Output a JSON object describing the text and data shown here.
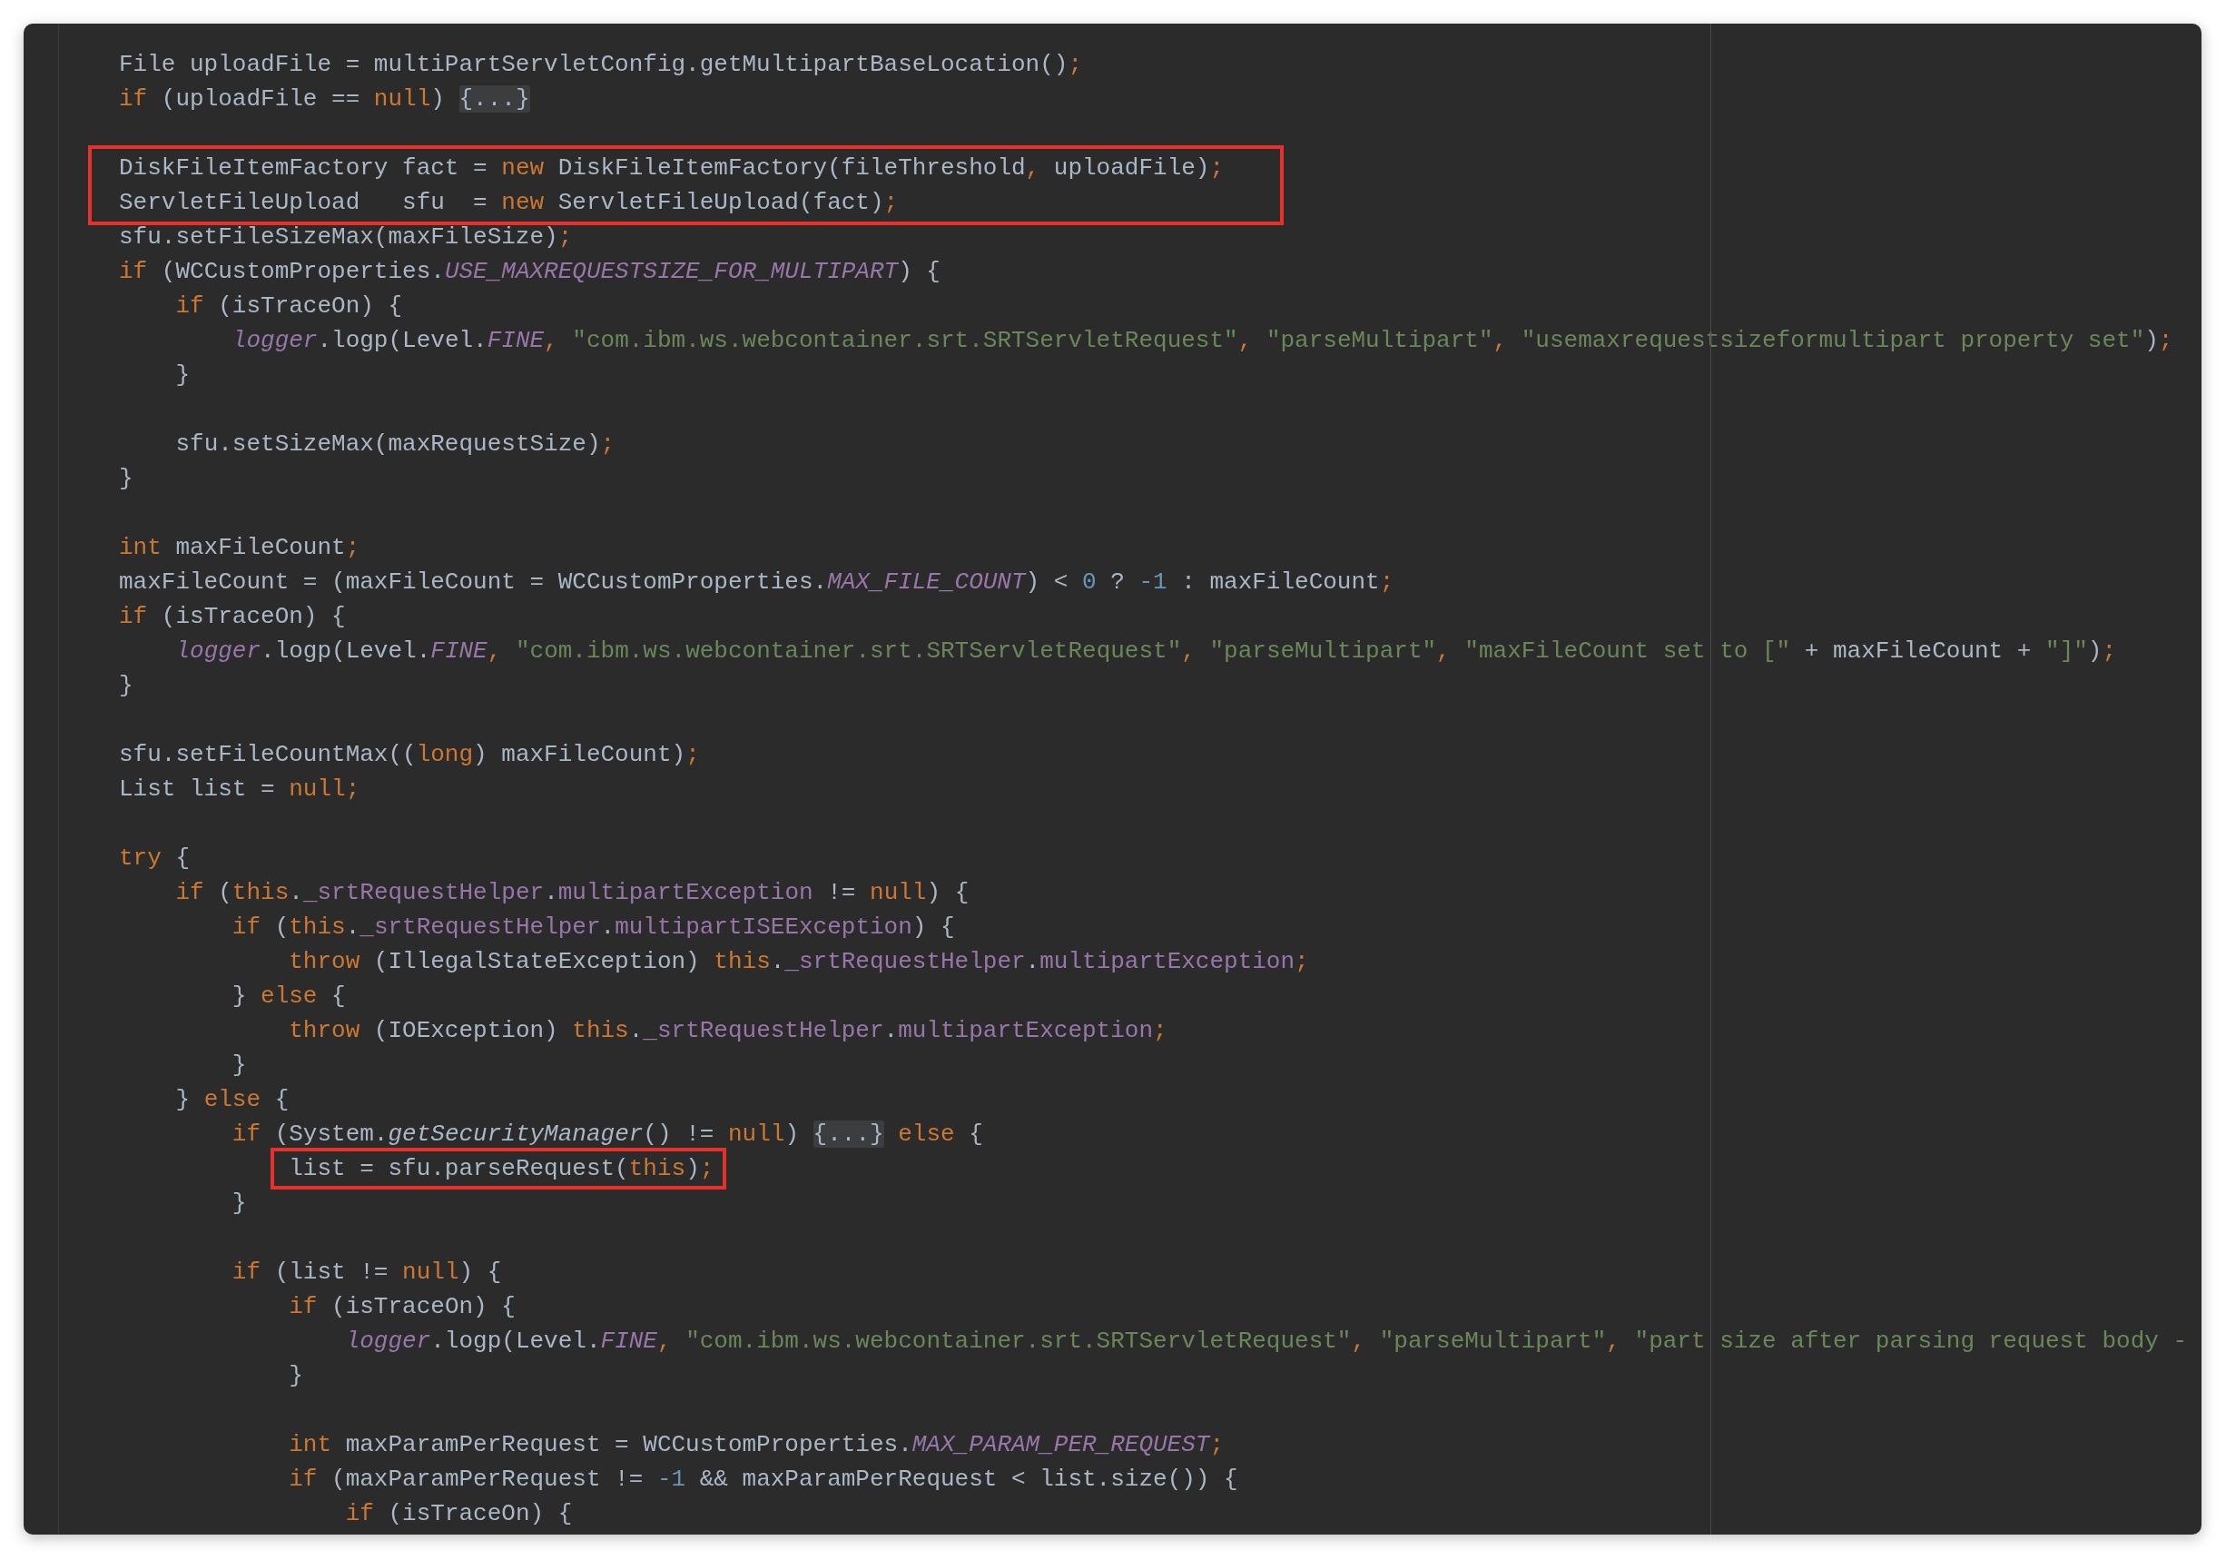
{
  "editor": {
    "lines": [
      {
        "kind": "code",
        "tokens": [
          {
            "kind": "plain",
            "text": "File uploadFile = multiPartServletConfig.getMultipartBaseLocation()"
          },
          {
            "kind": "keyword",
            "text": ";"
          }
        ]
      },
      {
        "kind": "code",
        "tokens": [
          {
            "kind": "keyword",
            "text": "if"
          },
          {
            "kind": "plain",
            "text": " (uploadFile == "
          },
          {
            "kind": "keyword",
            "text": "null"
          },
          {
            "kind": "plain",
            "text": ") "
          },
          {
            "kind": "fold",
            "text": "{...}"
          }
        ]
      },
      {
        "kind": "blank"
      },
      {
        "kind": "code",
        "boxed": true,
        "tokens": [
          {
            "kind": "plain",
            "text": "DiskFileItemFactory fact = "
          },
          {
            "kind": "keyword",
            "text": "new"
          },
          {
            "kind": "plain",
            "text": " DiskFileItemFactory(fileThreshold"
          },
          {
            "kind": "keyword",
            "text": ","
          },
          {
            "kind": "plain",
            "text": " uploadFile)"
          },
          {
            "kind": "keyword",
            "text": ";"
          }
        ]
      },
      {
        "kind": "code",
        "boxed": true,
        "tokens": [
          {
            "kind": "plain",
            "text": "ServletFileUpload   sfu  = "
          },
          {
            "kind": "keyword",
            "text": "new"
          },
          {
            "kind": "plain",
            "text": " ServletFileUpload(fact)"
          },
          {
            "kind": "keyword",
            "text": ";"
          }
        ]
      },
      {
        "kind": "code",
        "tokens": [
          {
            "kind": "plain",
            "text": "sfu.setFileSizeMax(maxFileSize)"
          },
          {
            "kind": "keyword",
            "text": ";"
          }
        ]
      },
      {
        "kind": "code",
        "tokens": [
          {
            "kind": "keyword",
            "text": "if"
          },
          {
            "kind": "plain",
            "text": " (WCCustomProperties."
          },
          {
            "kind": "static",
            "text": "USE_MAXREQUESTSIZE_FOR_MULTIPART"
          },
          {
            "kind": "plain",
            "text": ") {"
          }
        ]
      },
      {
        "kind": "code",
        "tokens": [
          {
            "kind": "keyword",
            "text": "    if"
          },
          {
            "kind": "plain",
            "text": " (isTraceOn) {"
          }
        ]
      },
      {
        "kind": "code",
        "tokens": [
          {
            "kind": "static",
            "text": "        logger"
          },
          {
            "kind": "plain",
            "text": ".logp(Level."
          },
          {
            "kind": "static",
            "text": "FINE"
          },
          {
            "kind": "keyword",
            "text": ", "
          },
          {
            "kind": "string",
            "text": "\"com.ibm.ws.webcontainer.srt.SRTServletRequest\""
          },
          {
            "kind": "keyword",
            "text": ", "
          },
          {
            "kind": "string",
            "text": "\"parseMultipart\""
          },
          {
            "kind": "keyword",
            "text": ", "
          },
          {
            "kind": "string",
            "text": "\"usemaxrequestsizeformultipart property set\""
          },
          {
            "kind": "plain",
            "text": ")"
          },
          {
            "kind": "keyword",
            "text": ";"
          }
        ]
      },
      {
        "kind": "code",
        "tokens": [
          {
            "kind": "plain",
            "text": "    }"
          }
        ]
      },
      {
        "kind": "blank"
      },
      {
        "kind": "code",
        "tokens": [
          {
            "kind": "plain",
            "text": "    sfu.setSizeMax(maxRequestSize)"
          },
          {
            "kind": "keyword",
            "text": ";"
          }
        ]
      },
      {
        "kind": "code",
        "tokens": [
          {
            "kind": "plain",
            "text": "}"
          }
        ]
      },
      {
        "kind": "blank"
      },
      {
        "kind": "code",
        "tokens": [
          {
            "kind": "keyword",
            "text": "int"
          },
          {
            "kind": "plain",
            "text": " maxFileCount"
          },
          {
            "kind": "keyword",
            "text": ";"
          }
        ]
      },
      {
        "kind": "code",
        "tokens": [
          {
            "kind": "plain",
            "text": "maxFileCount = (maxFileCount = WCCustomProperties."
          },
          {
            "kind": "static",
            "text": "MAX_FILE_COUNT"
          },
          {
            "kind": "plain",
            "text": ") < "
          },
          {
            "kind": "number",
            "text": "0"
          },
          {
            "kind": "plain",
            "text": " ? "
          },
          {
            "kind": "number",
            "text": "-1"
          },
          {
            "kind": "plain",
            "text": " : maxFileCount"
          },
          {
            "kind": "keyword",
            "text": ";"
          }
        ]
      },
      {
        "kind": "code",
        "tokens": [
          {
            "kind": "keyword",
            "text": "if"
          },
          {
            "kind": "plain",
            "text": " (isTraceOn) {"
          }
        ]
      },
      {
        "kind": "code",
        "tokens": [
          {
            "kind": "static",
            "text": "    logger"
          },
          {
            "kind": "plain",
            "text": ".logp(Level."
          },
          {
            "kind": "static",
            "text": "FINE"
          },
          {
            "kind": "keyword",
            "text": ", "
          },
          {
            "kind": "string",
            "text": "\"com.ibm.ws.webcontainer.srt.SRTServletRequest\""
          },
          {
            "kind": "keyword",
            "text": ", "
          },
          {
            "kind": "string",
            "text": "\"parseMultipart\""
          },
          {
            "kind": "keyword",
            "text": ", "
          },
          {
            "kind": "string",
            "text": "\"maxFileCount set to [\""
          },
          {
            "kind": "plain",
            "text": " + maxFileCount + "
          },
          {
            "kind": "string",
            "text": "\"]\""
          },
          {
            "kind": "plain",
            "text": ")"
          },
          {
            "kind": "keyword",
            "text": ";"
          }
        ]
      },
      {
        "kind": "code",
        "tokens": [
          {
            "kind": "plain",
            "text": "}"
          }
        ]
      },
      {
        "kind": "blank"
      },
      {
        "kind": "code",
        "tokens": [
          {
            "kind": "plain",
            "text": "sfu.setFileCountMax(("
          },
          {
            "kind": "keyword",
            "text": "long"
          },
          {
            "kind": "plain",
            "text": ") maxFileCount)"
          },
          {
            "kind": "keyword",
            "text": ";"
          }
        ]
      },
      {
        "kind": "code",
        "tokens": [
          {
            "kind": "plain",
            "text": "List list = "
          },
          {
            "kind": "keyword",
            "text": "null;"
          }
        ]
      },
      {
        "kind": "blank"
      },
      {
        "kind": "code",
        "tokens": [
          {
            "kind": "keyword",
            "text": "try"
          },
          {
            "kind": "plain",
            "text": " {"
          }
        ]
      },
      {
        "kind": "code",
        "tokens": [
          {
            "kind": "keyword",
            "text": "    if"
          },
          {
            "kind": "plain",
            "text": " ("
          },
          {
            "kind": "keyword",
            "text": "this"
          },
          {
            "kind": "plain",
            "text": "."
          },
          {
            "kind": "field",
            "text": "_srtRequestHelper"
          },
          {
            "kind": "plain",
            "text": "."
          },
          {
            "kind": "field",
            "text": "multipartException"
          },
          {
            "kind": "plain",
            "text": " != "
          },
          {
            "kind": "keyword",
            "text": "null"
          },
          {
            "kind": "plain",
            "text": ") {"
          }
        ]
      },
      {
        "kind": "code",
        "tokens": [
          {
            "kind": "keyword",
            "text": "        if"
          },
          {
            "kind": "plain",
            "text": " ("
          },
          {
            "kind": "keyword",
            "text": "this"
          },
          {
            "kind": "plain",
            "text": "."
          },
          {
            "kind": "field",
            "text": "_srtRequestHelper"
          },
          {
            "kind": "plain",
            "text": "."
          },
          {
            "kind": "field",
            "text": "multipartISEException"
          },
          {
            "kind": "plain",
            "text": ") {"
          }
        ]
      },
      {
        "kind": "code",
        "tokens": [
          {
            "kind": "keyword",
            "text": "            throw"
          },
          {
            "kind": "plain",
            "text": " (IllegalStateException) "
          },
          {
            "kind": "keyword",
            "text": "this"
          },
          {
            "kind": "plain",
            "text": "."
          },
          {
            "kind": "field",
            "text": "_srtRequestHelper"
          },
          {
            "kind": "plain",
            "text": "."
          },
          {
            "kind": "field",
            "text": "multipartException"
          },
          {
            "kind": "keyword",
            "text": ";"
          }
        ]
      },
      {
        "kind": "code",
        "tokens": [
          {
            "kind": "plain",
            "text": "        } "
          },
          {
            "kind": "keyword",
            "text": "else"
          },
          {
            "kind": "plain",
            "text": " {"
          }
        ]
      },
      {
        "kind": "code",
        "tokens": [
          {
            "kind": "keyword",
            "text": "            throw"
          },
          {
            "kind": "plain",
            "text": " (IOException) "
          },
          {
            "kind": "keyword",
            "text": "this"
          },
          {
            "kind": "plain",
            "text": "."
          },
          {
            "kind": "field",
            "text": "_srtRequestHelper"
          },
          {
            "kind": "plain",
            "text": "."
          },
          {
            "kind": "field",
            "text": "multipartException"
          },
          {
            "kind": "keyword",
            "text": ";"
          }
        ]
      },
      {
        "kind": "code",
        "tokens": [
          {
            "kind": "plain",
            "text": "        }"
          }
        ]
      },
      {
        "kind": "code",
        "tokens": [
          {
            "kind": "plain",
            "text": "    } "
          },
          {
            "kind": "keyword",
            "text": "else"
          },
          {
            "kind": "plain",
            "text": " {"
          }
        ]
      },
      {
        "kind": "code",
        "tokens": [
          {
            "kind": "keyword",
            "text": "        if"
          },
          {
            "kind": "plain",
            "text": " (System."
          },
          {
            "kind": "italic",
            "text": "getSecurityManager"
          },
          {
            "kind": "plain",
            "text": "() != "
          },
          {
            "kind": "keyword",
            "text": "null"
          },
          {
            "kind": "plain",
            "text": ") "
          },
          {
            "kind": "fold",
            "text": "{...}"
          },
          {
            "kind": "keyword",
            "text": " else"
          },
          {
            "kind": "plain",
            "text": " {"
          }
        ]
      },
      {
        "kind": "code",
        "boxed": true,
        "tokens": [
          {
            "kind": "plain",
            "text": "            list = sfu.parseRequest("
          },
          {
            "kind": "keyword",
            "text": "this"
          },
          {
            "kind": "plain",
            "text": ")"
          },
          {
            "kind": "keyword",
            "text": ";"
          }
        ]
      },
      {
        "kind": "code",
        "tokens": [
          {
            "kind": "plain",
            "text": "        }"
          }
        ]
      },
      {
        "kind": "blank"
      },
      {
        "kind": "code",
        "tokens": [
          {
            "kind": "keyword",
            "text": "        if"
          },
          {
            "kind": "plain",
            "text": " (list != "
          },
          {
            "kind": "keyword",
            "text": "null"
          },
          {
            "kind": "plain",
            "text": ") {"
          }
        ]
      },
      {
        "kind": "code",
        "tokens": [
          {
            "kind": "keyword",
            "text": "            if"
          },
          {
            "kind": "plain",
            "text": " (isTraceOn) {"
          }
        ]
      },
      {
        "kind": "code",
        "tokens": [
          {
            "kind": "static",
            "text": "                logger"
          },
          {
            "kind": "plain",
            "text": ".logp(Level."
          },
          {
            "kind": "static",
            "text": "FINE"
          },
          {
            "kind": "keyword",
            "text": ", "
          },
          {
            "kind": "string",
            "text": "\"com.ibm.ws.webcontainer.srt.SRTServletRequest\""
          },
          {
            "kind": "keyword",
            "text": ", "
          },
          {
            "kind": "string",
            "text": "\"parseMultipart\""
          },
          {
            "kind": "keyword",
            "text": ", "
          },
          {
            "kind": "string",
            "text": "\"part size after parsing request body -"
          }
        ]
      },
      {
        "kind": "code",
        "tokens": [
          {
            "kind": "plain",
            "text": "            }"
          }
        ]
      },
      {
        "kind": "blank"
      },
      {
        "kind": "code",
        "tokens": [
          {
            "kind": "keyword",
            "text": "            int"
          },
          {
            "kind": "plain",
            "text": " maxParamPerRequest = WCCustomProperties."
          },
          {
            "kind": "static",
            "text": "MAX_PARAM_PER_REQUEST"
          },
          {
            "kind": "keyword",
            "text": ";"
          }
        ]
      },
      {
        "kind": "code",
        "tokens": [
          {
            "kind": "keyword",
            "text": "            if"
          },
          {
            "kind": "plain",
            "text": " (maxParamPerRequest != "
          },
          {
            "kind": "number",
            "text": "-1"
          },
          {
            "kind": "plain",
            "text": " && maxParamPerRequest < list.size()) {"
          }
        ]
      },
      {
        "kind": "code",
        "tokens": [
          {
            "kind": "keyword",
            "text": "                if"
          },
          {
            "kind": "plain",
            "text": " (isTraceOn) {"
          }
        ]
      }
    ]
  }
}
